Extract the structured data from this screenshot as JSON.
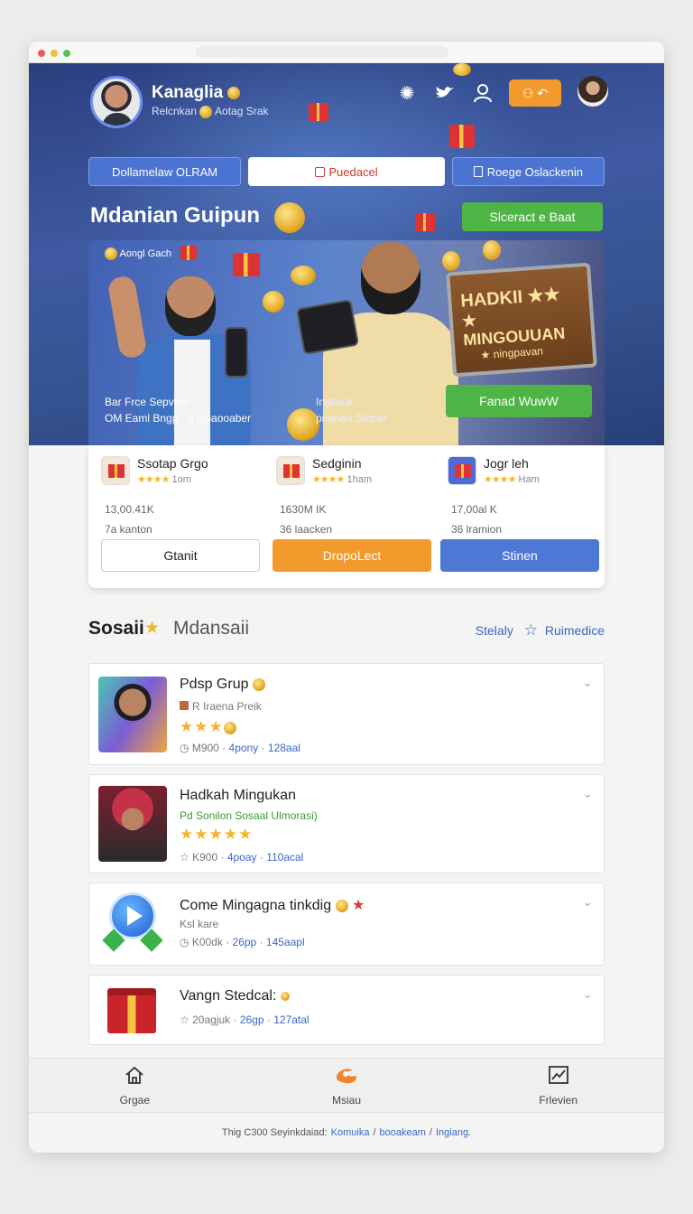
{
  "header": {
    "username": "Kanaglia",
    "subtitle": "Relcnkan",
    "subtitle2": "Aotag Srak",
    "login_label": "⚇ ↶"
  },
  "tabs": [
    {
      "label": "Dollamelaw OLRAM"
    },
    {
      "label": "Puedacel"
    },
    {
      "label": "Roege Oslackenin"
    }
  ],
  "hero": {
    "title": "Mdanian Guipun",
    "green_button": "Slceract e Baat",
    "banner_label": "Aongl Gach",
    "banner_left_line1": "Bar Frce Sepvten",
    "banner_left_line2": "OM Eaml Bngp · a lapaooaber",
    "banner_mid_line1": "Ingllauk",
    "banner_mid_line2": "pnanan Stoper",
    "sign_line1": "HADKII ★★",
    "sign_line2": "★ MINGOUUAN",
    "sign_line3": "★ ningpavan",
    "banner_green_button": "Fanad WuwW"
  },
  "card": {
    "columns": [
      {
        "name": "Ssotap Grgo",
        "rating": "1om",
        "value": "13,00.41K",
        "extra": "7a kanton"
      },
      {
        "name": "Sedginin",
        "rating": "1ham",
        "value": "1630M IK",
        "extra": "36 laacken"
      },
      {
        "name": "Jogr leh",
        "rating": "Ham",
        "value": "17,00al K",
        "extra": "36 lramion"
      }
    ],
    "buttons": [
      "Gtanit",
      "DropoLect",
      "Stinen"
    ]
  },
  "section": {
    "title": "Sosaii",
    "title2": "Mdansaii",
    "right1": "Stelaly",
    "right2": "Ruimedice"
  },
  "list": [
    {
      "title": "Pdsp Grup",
      "sub": "R Iraena Preik",
      "meta1": "M900",
      "meta2": "4pony",
      "meta3": "128aal"
    },
    {
      "title": "Hadkah Mingukan",
      "sub": "Pd Sonilon Sosaal Ulmorasi)",
      "meta1": "K900",
      "meta2": "4poay",
      "meta3": "110acal"
    },
    {
      "title": "Come Mingagna tinkdig",
      "sub": "Ksl kare",
      "meta1": "K00dk",
      "meta2": "26pp",
      "meta3": "145aapl"
    },
    {
      "title": "Vangn Stedcal:",
      "sub": "",
      "meta1": "20agjuk",
      "meta2": "26gp",
      "meta3": "127atal"
    }
  ],
  "bottomnav": [
    {
      "label": "Grgae",
      "icon": "home-icon"
    },
    {
      "label": "Msiau",
      "icon": "flame-icon"
    },
    {
      "label": "Frlevien",
      "icon": "chart-icon"
    }
  ],
  "footer": {
    "text": "Thig C300 Seyinkdaiad:",
    "link1": "Komuika",
    "sep": "/",
    "link2": "booakeam",
    "link3": "Ingiang."
  },
  "colors": {
    "accent": "#4d78d6",
    "orange": "#f39a2c",
    "green": "#4fb446",
    "hero_bg": "#34528f"
  }
}
